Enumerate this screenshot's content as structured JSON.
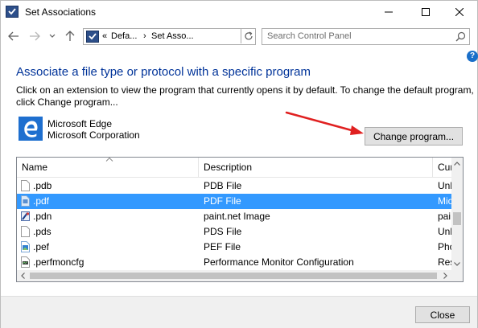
{
  "window": {
    "title": "Set Associations"
  },
  "nav": {
    "breadcrumb_sep": "«",
    "crumb1": "Defa...",
    "crumb_arrow": "›",
    "crumb2": "Set Asso...",
    "search_placeholder": "Search Control Panel"
  },
  "help_label": "?",
  "content": {
    "heading": "Associate a file type or protocol with a specific program",
    "description": "Click on an extension to view the program that currently opens it by default. To change the default program, click Change program...",
    "program_name": "Microsoft Edge",
    "program_company": "Microsoft Corporation",
    "change_button": "Change program..."
  },
  "list": {
    "columns": [
      "Name",
      "Description",
      "Cur"
    ],
    "rows": [
      {
        "name": ".pdb",
        "description": "PDB File",
        "current": "Unl",
        "icon": "blank-file-icon",
        "selected": false
      },
      {
        "name": ".pdf",
        "description": "PDF File",
        "current": "Mic",
        "icon": "pdf-file-icon",
        "selected": true
      },
      {
        "name": ".pdn",
        "description": "paint.net Image",
        "current": "pai",
        "icon": "paintnet-icon",
        "selected": false
      },
      {
        "name": ".pds",
        "description": "PDS File",
        "current": "Unl",
        "icon": "blank-file-icon",
        "selected": false
      },
      {
        "name": ".pef",
        "description": "PEF File",
        "current": "Pho",
        "icon": "image-file-icon",
        "selected": false
      },
      {
        "name": ".perfmoncfg",
        "description": "Performance Monitor Configuration",
        "current": "Res",
        "icon": "perfmon-icon",
        "selected": false
      }
    ]
  },
  "footer": {
    "close_button": "Close"
  },
  "colors": {
    "accent": "#003399",
    "selection": "#3399ff",
    "annotation_arrow": "#e02020"
  }
}
